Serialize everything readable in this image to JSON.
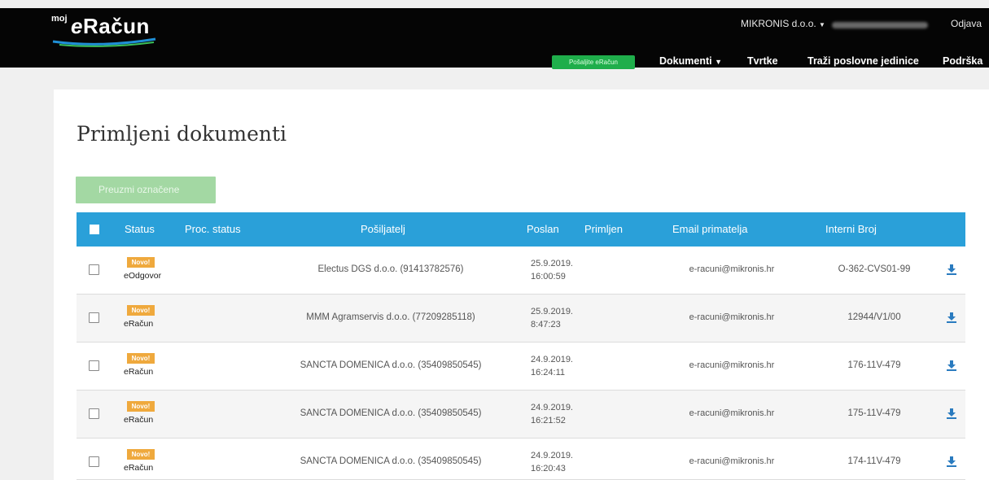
{
  "header": {
    "logo_prefix": "moj",
    "logo_e": "e",
    "logo_rest": "Račun",
    "company": "MIKRONIS d.o.o.",
    "logout": "Odjava",
    "nav": {
      "send": "Pošaljite eRačun",
      "documents": "Dokumenti",
      "companies": "Tvrtke",
      "search_units": "Traži poslovne jedinice",
      "support": "Podrška"
    }
  },
  "page": {
    "title": "Primljeni dokumenti",
    "download_selected": "Preuzmi označene"
  },
  "table": {
    "columns": {
      "status": "Status",
      "proc_status": "Proc. status",
      "sender": "Pošiljatelj",
      "sent": "Poslan",
      "received": "Primljen",
      "email": "Email primatelja",
      "internal": "Interni Broj"
    },
    "rows": [
      {
        "badge": "Novo!",
        "doc_type": "eOdgovor",
        "sender": "Electus DGS d.o.o. (91413782576)",
        "sent_date": "25.9.2019.",
        "sent_time": "16:00:59",
        "email": "e-racuni@mikronis.hr",
        "internal": "O-362-CVS01-99"
      },
      {
        "badge": "Novo!",
        "doc_type": "eRačun",
        "sender": "MMM Agramservis d.o.o. (77209285118)",
        "sent_date": "25.9.2019.",
        "sent_time": "8:47:23",
        "email": "e-racuni@mikronis.hr",
        "internal": "12944/V1/00"
      },
      {
        "badge": "Novo!",
        "doc_type": "eRačun",
        "sender": "SANCTA DOMENICA d.o.o. (35409850545)",
        "sent_date": "24.9.2019.",
        "sent_time": "16:24:11",
        "email": "e-racuni@mikronis.hr",
        "internal": "176-11V-479"
      },
      {
        "badge": "Novo!",
        "doc_type": "eRačun",
        "sender": "SANCTA DOMENICA d.o.o. (35409850545)",
        "sent_date": "24.9.2019.",
        "sent_time": "16:21:52",
        "email": "e-racuni@mikronis.hr",
        "internal": "175-11V-479"
      },
      {
        "badge": "Novo!",
        "doc_type": "eRačun",
        "sender": "SANCTA DOMENICA d.o.o. (35409850545)",
        "sent_date": "24.9.2019.",
        "sent_time": "16:20:43",
        "email": "e-racuni@mikronis.hr",
        "internal": "174-11V-479"
      }
    ]
  }
}
